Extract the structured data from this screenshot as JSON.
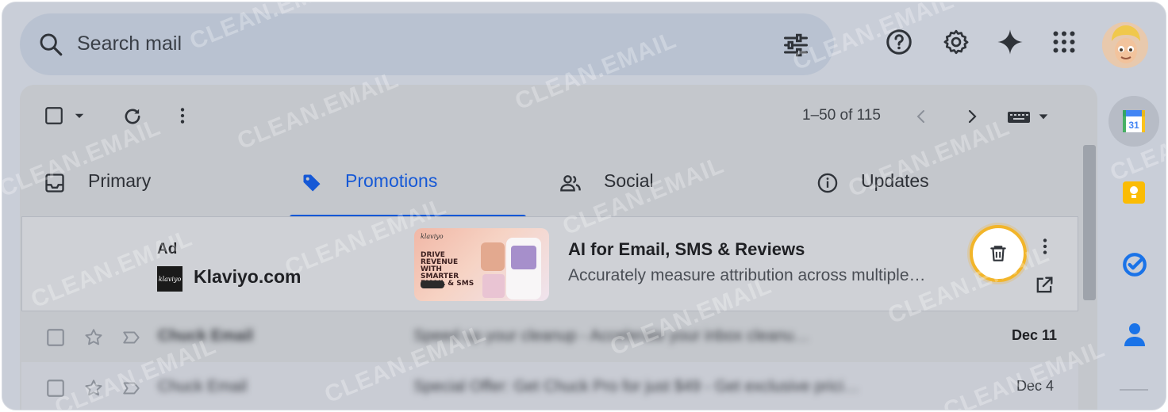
{
  "search": {
    "placeholder": "Search mail"
  },
  "toolbar": {
    "pagination": "1–50 of 115"
  },
  "tabs": [
    {
      "label": "Primary"
    },
    {
      "label": "Promotions"
    },
    {
      "label": "Social"
    },
    {
      "label": "Updates"
    }
  ],
  "active_tab": "Promotions",
  "ad": {
    "tag": "Ad",
    "logo_text": "klaviyo",
    "sender": "Klaviyo.com",
    "image_brand": "klaviyo",
    "image_headline": "DRIVE REVENUE WITH SMARTER EMAIL & SMS",
    "subject": "AI for Email, SMS & Reviews",
    "snippet": "Accurately measure attribution across multiple…"
  },
  "rows": [
    {
      "sender": "Chuck Email",
      "subject": "Speed up your cleanup - Accelerate your inbox cleanu…",
      "date": "Dec 11",
      "unread": true
    },
    {
      "sender": "Chuck Email",
      "subject": "Special Offer: Get Chuck Pro for just $49 - Get exclusive prici…",
      "date": "Dec 4",
      "unread": false
    }
  ],
  "calendar_day": "31",
  "watermark": "CLEAN.EMAIL",
  "colors": {
    "accent": "#1558d6",
    "highlight": "#f2b52a"
  }
}
